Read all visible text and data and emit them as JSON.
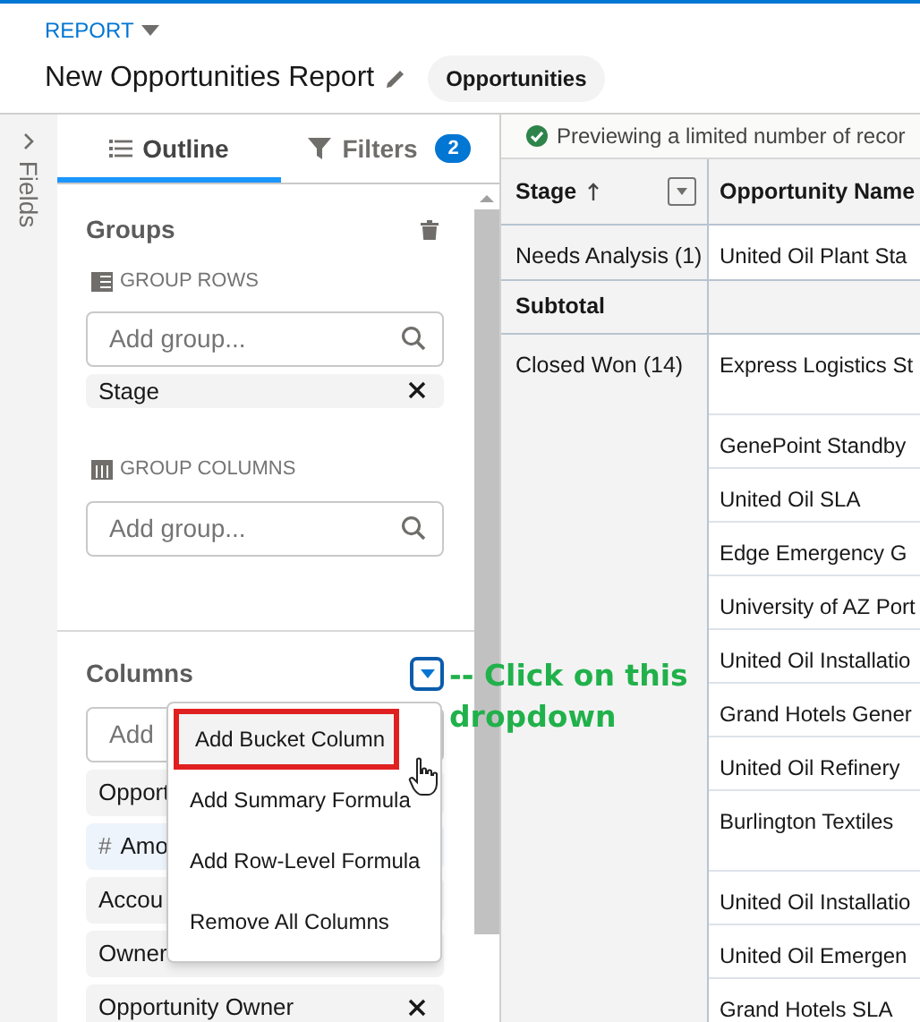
{
  "header": {
    "breadcrumb": "REPORT",
    "title": "New Opportunities Report",
    "object_badge": "Opportunities"
  },
  "fields_rail": {
    "label": "Fields"
  },
  "tabs": [
    {
      "label": "Outline",
      "selected": true
    },
    {
      "label": "Filters",
      "selected": false,
      "count": "2"
    }
  ],
  "groups": {
    "title": "Groups",
    "group_rows": {
      "label": "GROUP ROWS",
      "placeholder": "Add group...",
      "items": [
        "Stage"
      ]
    },
    "group_columns": {
      "label": "GROUP COLUMNS",
      "placeholder": "Add group..."
    }
  },
  "columns": {
    "title": "Columns",
    "placeholder": "Add",
    "items": [
      {
        "label": "Opport",
        "kind": "text"
      },
      {
        "label": "Amo",
        "kind": "number",
        "type_symbol": "#"
      },
      {
        "label": "Accou",
        "kind": "text"
      },
      {
        "label": "Owner",
        "kind": "text"
      },
      {
        "label": "Opportunity Owner",
        "kind": "text"
      }
    ]
  },
  "columns_menu": [
    {
      "label": "Add Bucket Column",
      "highlighted": true
    },
    {
      "label": "Add Summary Formula",
      "highlighted": false
    },
    {
      "label": "Add Row-Level Formula",
      "highlighted": false
    },
    {
      "label": "Remove All Columns",
      "highlighted": false
    }
  ],
  "annotation": {
    "line_1": "-- Click on this",
    "line_2": "dropdown"
  },
  "preview_notice": "Previewing a limited number of recor",
  "table": {
    "columns": [
      "Stage",
      "Opportunity Name"
    ],
    "groups": [
      {
        "stage": "Needs Analysis (1)",
        "rows": [
          {
            "name": "United Oil Plant Sta",
            "tall": false
          }
        ]
      },
      {
        "subtotal": "Subtotal"
      },
      {
        "stage": "Closed Won (14)",
        "rows": [
          {
            "name": "Express Logistics St",
            "tall": true
          },
          {
            "name": "GenePoint Standby",
            "tall": false
          },
          {
            "name": "United Oil SLA",
            "tall": false
          },
          {
            "name": "Edge Emergency G",
            "tall": false
          },
          {
            "name": "University of AZ Port",
            "tall": false
          },
          {
            "name": "United Oil Installatio",
            "tall": false
          },
          {
            "name": "Grand Hotels Gener",
            "tall": false
          },
          {
            "name": "United Oil Refinery",
            "tall": false
          },
          {
            "name": "Burlington Textiles",
            "tall": true
          },
          {
            "name": "United Oil Installatio",
            "tall": false
          },
          {
            "name": "United Oil Emergen",
            "tall": false
          },
          {
            "name": "Grand Hotels SLA",
            "tall": false
          }
        ]
      }
    ]
  }
}
